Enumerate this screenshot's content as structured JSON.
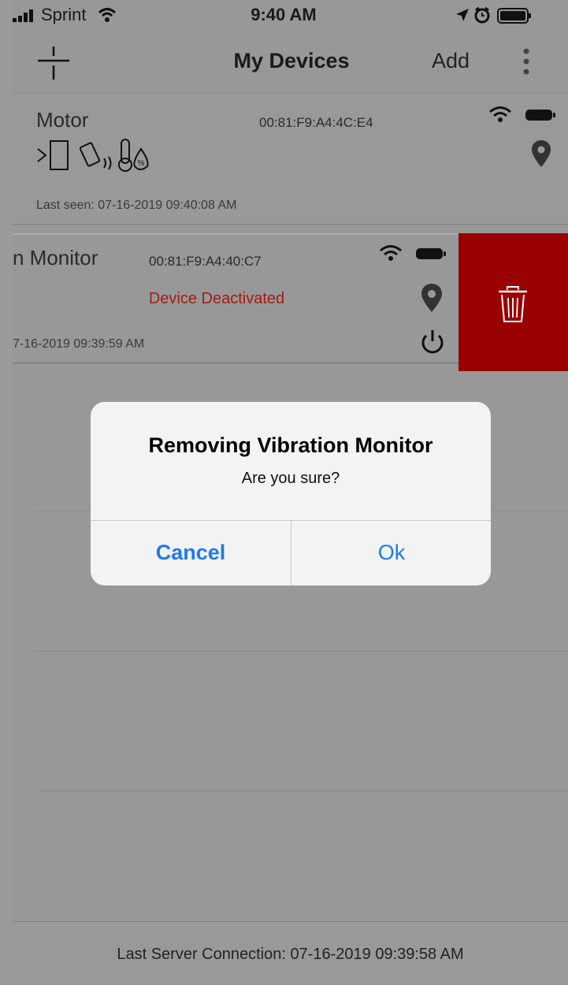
{
  "status_bar": {
    "carrier": "Sprint",
    "time": "9:40 AM"
  },
  "nav": {
    "title": "My Devices",
    "add_label": "Add"
  },
  "devices": [
    {
      "name": "Motor",
      "mac": "00:81:F9:A4:4C:E4",
      "last_seen": "Last seen: 07-16-2019 09:40:08 AM",
      "icons": [
        "signal-icon",
        "vibration-icon",
        "temperature-humidity-icon",
        "wifi-icon",
        "battery-icon",
        "location-pin-icon"
      ]
    },
    {
      "name": "n Monitor",
      "mac": "00:81:F9:A4:40:C7",
      "status": "Device Deactivated",
      "last_seen": "7-16-2019 09:39:59 AM",
      "icons": [
        "wifi-icon",
        "battery-icon",
        "location-pin-icon",
        "power-icon"
      ]
    }
  ],
  "colors": {
    "accent": "#1c7bf2",
    "delete": "#9a0000",
    "deactivated": "#a21d14"
  },
  "footer": {
    "text": "Last Server Connection: 07-16-2019 09:39:58 AM"
  },
  "alert": {
    "title": "Removing Vibration Monitor",
    "message": "Are you sure?",
    "cancel_label": "Cancel",
    "ok_label": "Ok"
  }
}
